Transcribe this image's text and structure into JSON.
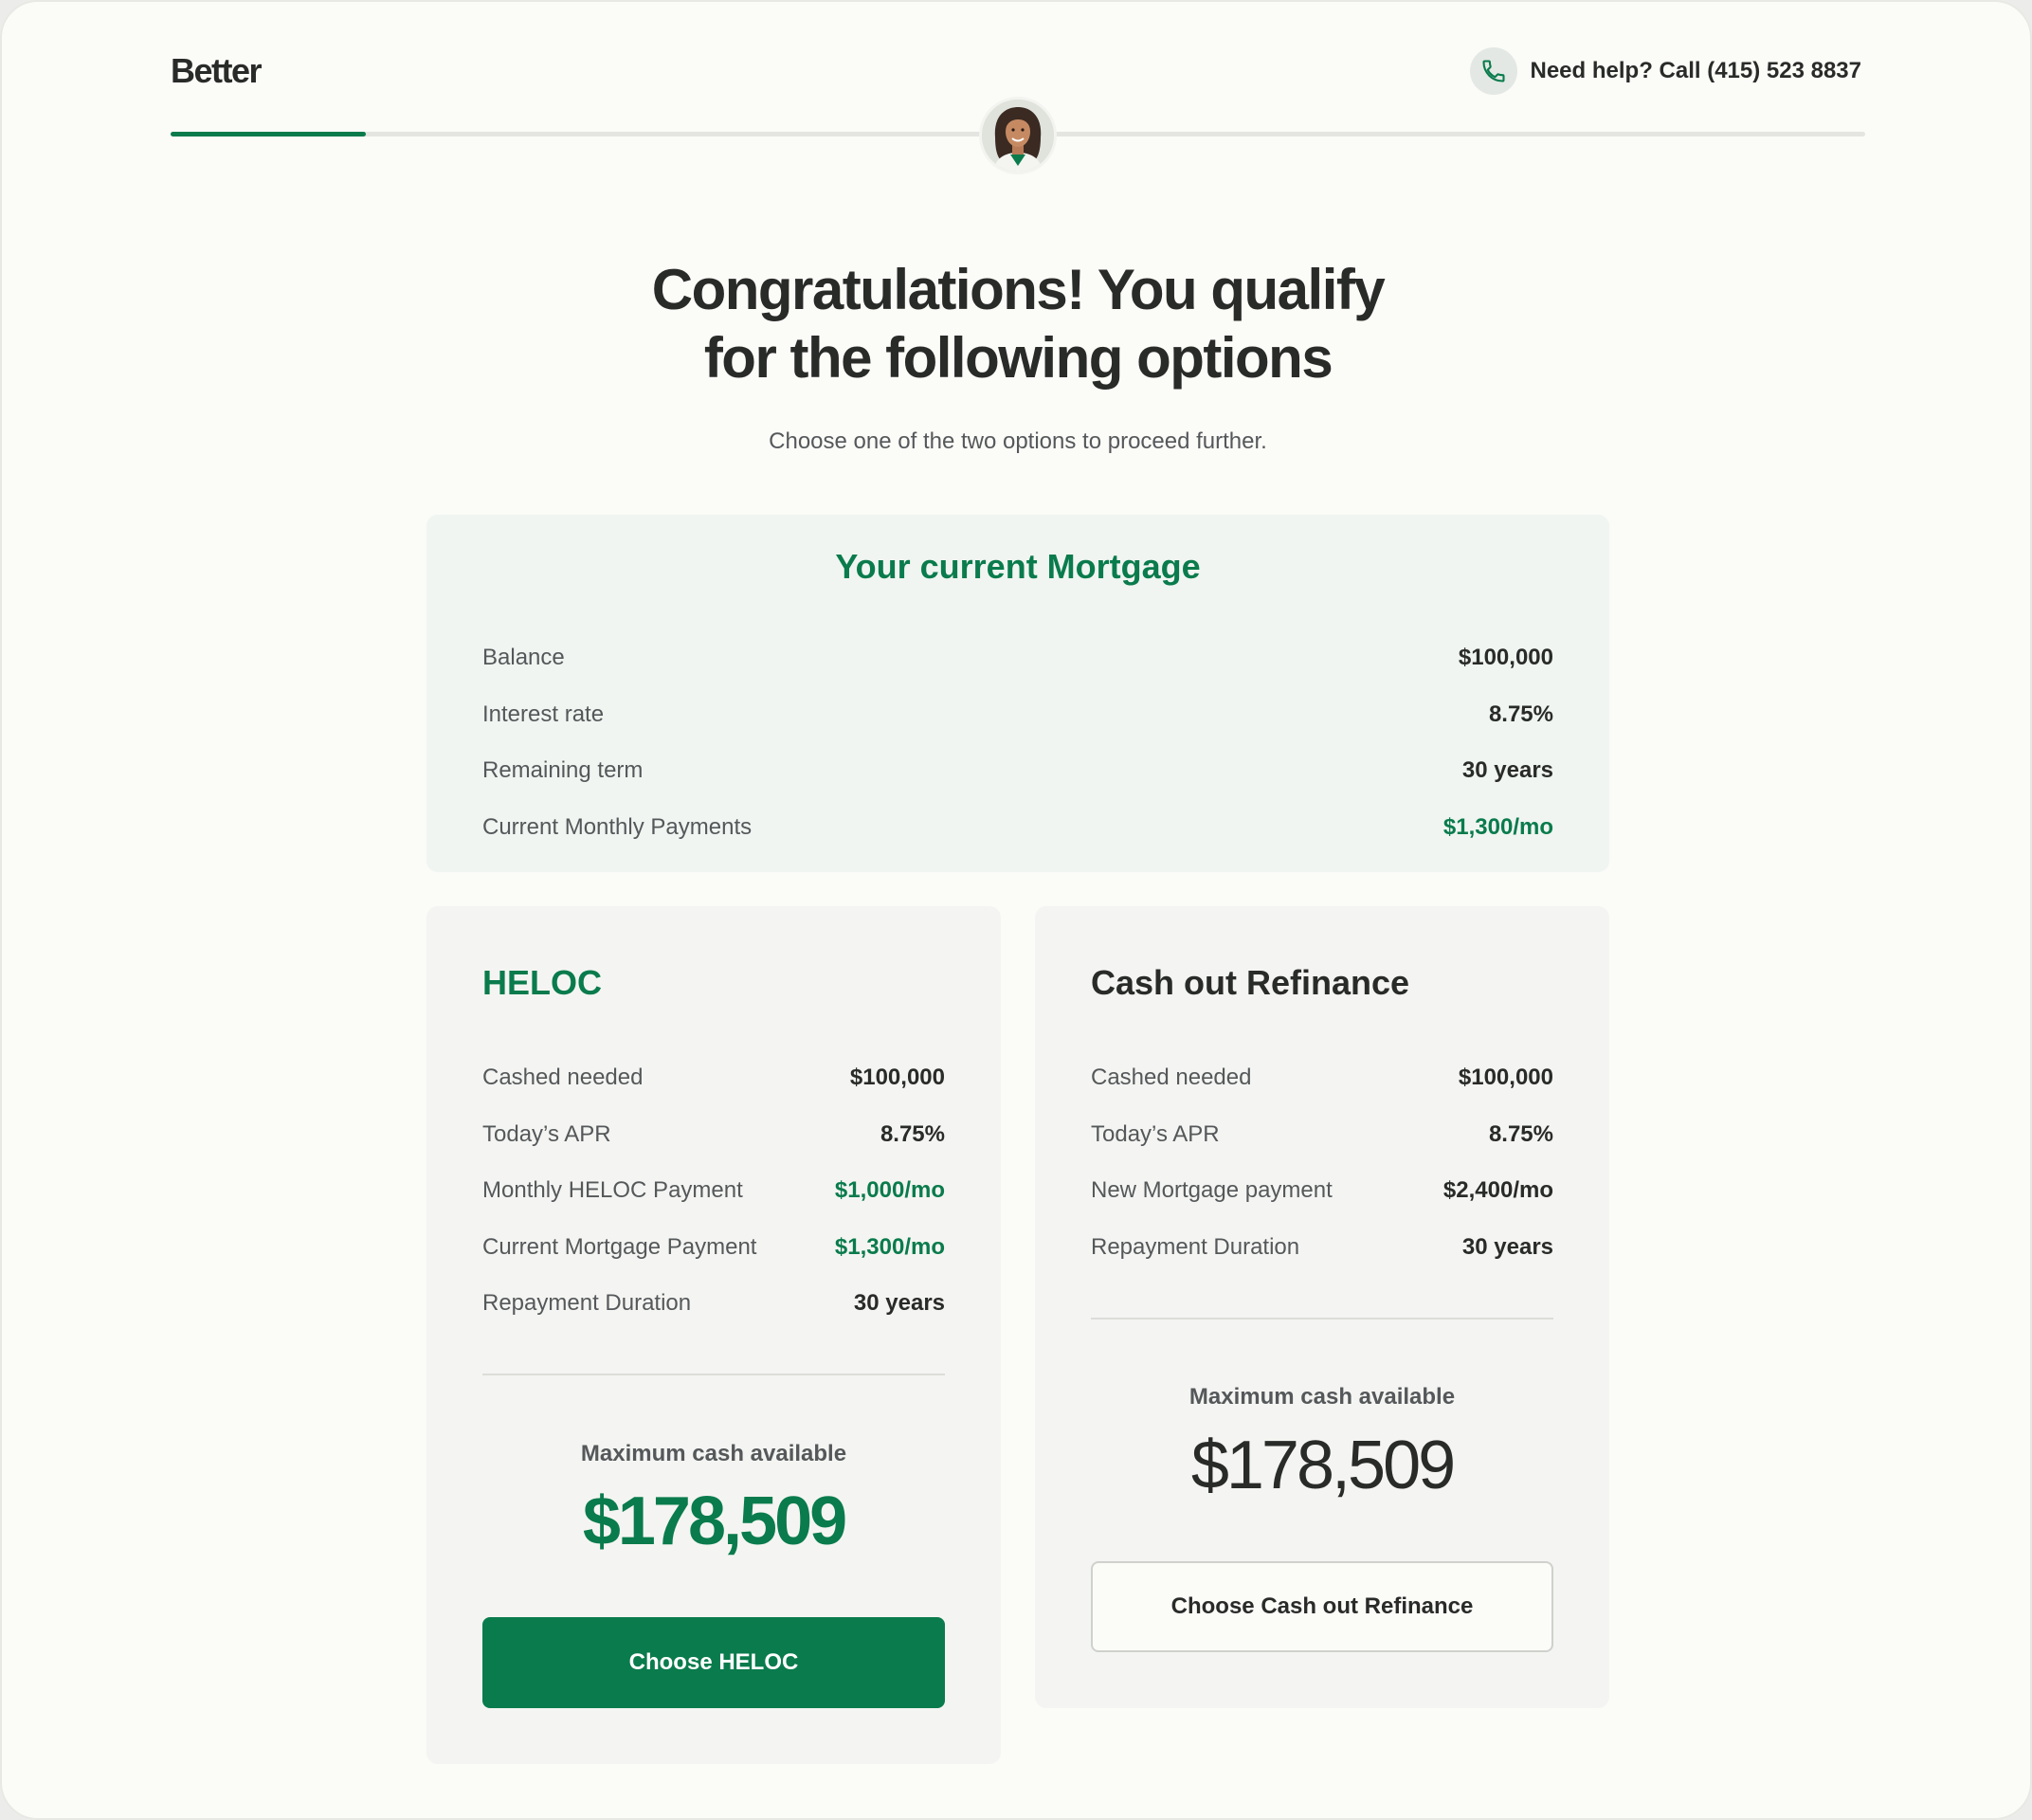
{
  "brand": {
    "logo": "Better",
    "accent": "#0a7b4c"
  },
  "header": {
    "help_text": "Need help? Call (415) 523 8837",
    "progress_fraction": 0.115
  },
  "main": {
    "title_line1": "Congratulations! You qualify",
    "title_line2": "for the following options",
    "subtitle": "Choose one of the two options to proceed further."
  },
  "current_mortgage": {
    "title": "Your current Mortgage",
    "rows": [
      {
        "label": "Balance",
        "value": "$100,000"
      },
      {
        "label": "Interest rate",
        "value": "8.75%"
      },
      {
        "label": "Remaining term",
        "value": "30 years"
      },
      {
        "label": "Current Monthly Payments",
        "value": "$1,300/mo"
      }
    ]
  },
  "heloc": {
    "title": "HELOC",
    "rows": [
      {
        "label": "Cashed needed",
        "value": "$100,000"
      },
      {
        "label": "Today’s APR",
        "value": "8.75%"
      },
      {
        "label": "Monthly HELOC Payment",
        "value": "$1,000/mo"
      },
      {
        "label": "Current Mortgage Payment",
        "value": "$1,300/mo"
      },
      {
        "label": "Repayment Duration",
        "value": "30 years"
      }
    ],
    "max_label": "Maximum cash available",
    "max_value": "$178,509",
    "button": "Choose HELOC"
  },
  "refinance": {
    "title": "Cash out Refinance",
    "rows": [
      {
        "label": "Cashed needed",
        "value": "$100,000"
      },
      {
        "label": "Today’s APR",
        "value": "8.75%"
      },
      {
        "label": "New Mortgage payment",
        "value": "$2,400/mo"
      },
      {
        "label": "Repayment Duration",
        "value": "30 years"
      }
    ],
    "max_label": "Maximum cash available",
    "max_value": "$178,509",
    "button": "Choose Cash out Refinance"
  },
  "icons": {
    "phone": "phone-icon",
    "avatar": "advisor-avatar"
  }
}
